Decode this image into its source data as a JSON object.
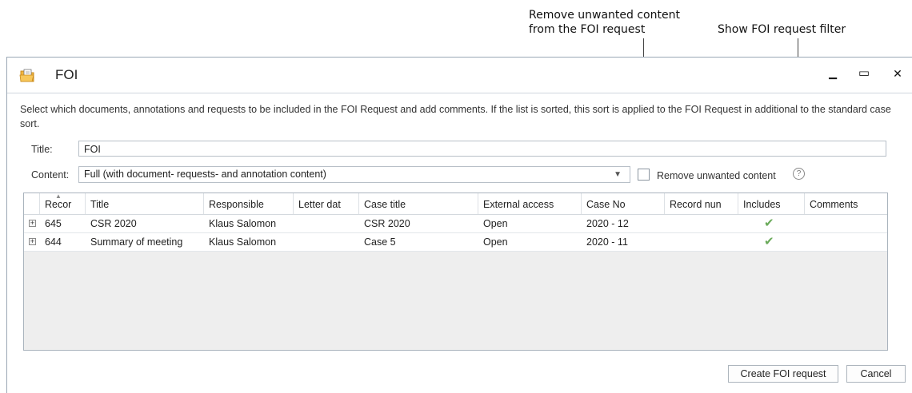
{
  "callouts": {
    "remove_unwanted_line1": "Remove unwanted content",
    "remove_unwanted_line2": "from the FOI request",
    "show_filter": "Show FOI request filter"
  },
  "window": {
    "title": "FOI",
    "minimize": "▁",
    "maximize": "▭",
    "close": "✕"
  },
  "description": "Select which documents, annotations and requests to be included in the FOI Request and add comments. If the list is sorted, this sort is applied to the FOI Request in additional to the standard case sort.",
  "form": {
    "title_label": "Title:",
    "title_value": "FOI",
    "content_label": "Content:",
    "content_value": "Full (with document- requests- and annotation content)",
    "remove_unwanted_label": "Remove unwanted content",
    "help_glyph": "?"
  },
  "table": {
    "columns": [
      "Recor",
      "Title",
      "Responsible",
      "Letter dat",
      "Case title",
      "External access",
      "Case No",
      "Record nun",
      "Includes",
      "Comments"
    ],
    "rows": [
      {
        "record": "645",
        "title": "CSR 2020",
        "responsible": "Klaus Salomon",
        "letter_date": "",
        "case_title": "CSR 2020",
        "external_access": "Open",
        "case_no": "2020 - 12",
        "record_num": "",
        "includes": "✔",
        "comments": ""
      },
      {
        "record": "644",
        "title": "Summary of meeting",
        "responsible": "Klaus Salomon",
        "letter_date": "",
        "case_title": "Case 5",
        "external_access": "Open",
        "case_no": "2020 - 11",
        "record_num": "",
        "includes": "✔",
        "comments": ""
      }
    ]
  },
  "buttons": {
    "create": "Create FOI request",
    "cancel": "Cancel"
  },
  "colors": {
    "check": "#6aaa5a",
    "border": "#a9b3bd"
  }
}
